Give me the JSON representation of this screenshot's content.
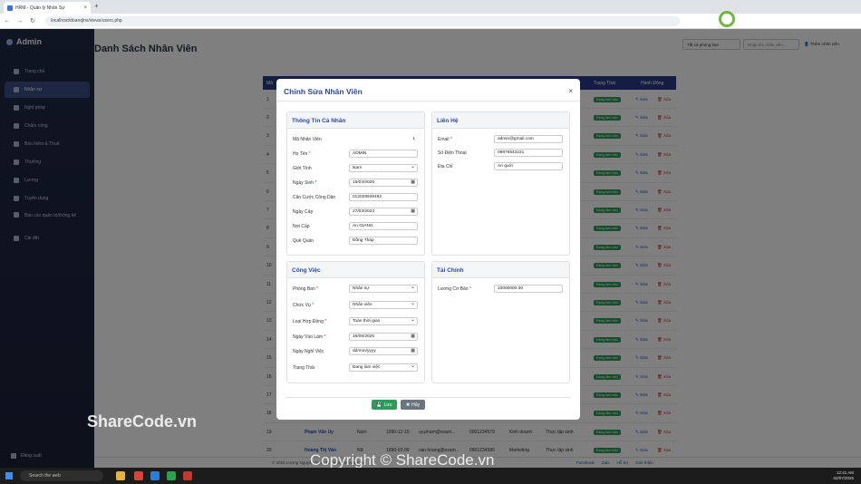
{
  "browser": {
    "tab_title": "HRM - Quản lý Nhân Sự",
    "url": "localhost/doanqlns/views/users.php"
  },
  "sidebar": {
    "brand": "Admin",
    "items": [
      {
        "label": "Trang chủ",
        "active": false
      },
      {
        "label": "Nhân sự",
        "active": true
      },
      {
        "label": "Nghỉ phép",
        "active": false
      },
      {
        "label": "Chấm công",
        "active": false
      },
      {
        "label": "Bảo hiểm & Thuế",
        "active": false
      },
      {
        "label": "Thưởng",
        "active": false
      },
      {
        "label": "Lương",
        "active": false
      },
      {
        "label": "Tuyển dụng",
        "active": false
      },
      {
        "label": "Báo cáo quản trị/thống kê",
        "active": false
      },
      {
        "label": "Cài đặt",
        "active": false
      }
    ],
    "logout": "Đăng xuất"
  },
  "page": {
    "title": "Danh Sách Nhân Viên",
    "filter_select": "Tất cả phòng ban",
    "search_placeholder": "Nhập tên nhân viên...",
    "add_button": "Thêm nhân viên"
  },
  "table": {
    "headers": {
      "id": "Mã",
      "status": "Trạng Thái",
      "actions": "Hành Động"
    },
    "row_numbers": [
      "1",
      "2",
      "3",
      "4",
      "5",
      "6",
      "7",
      "8",
      "9",
      "10",
      "11",
      "12",
      "13",
      "14",
      "15",
      "16",
      "17",
      "18",
      "19",
      "20"
    ],
    "status_badge": "Đang làm việc",
    "edit_label": "Sửa",
    "delete_label": "Xóa",
    "partial_rows": [
      {
        "num": "19",
        "name": "Phạm Văn Uy",
        "gender": "Nam",
        "dob": "1990-12-15",
        "email": "uy.pham@exam...",
        "phone": "0901234579",
        "dept": "Kinh doanh",
        "type": "Thực tập sinh"
      },
      {
        "num": "20",
        "name": "Hoàng Thị Vân",
        "gender": "Nữ",
        "dob": "1990-02-09",
        "email": "van.hoang@exam...",
        "phone": "0901234580",
        "dept": "Marketing",
        "type": "Thực tập sinh"
      }
    ]
  },
  "footer": {
    "copyright": "© 2025 Lương Nguyễn Ngọc Trí. All rights reserved.",
    "links": [
      "Facebook",
      "Zalo",
      "Hỗ trợ",
      "Giới thiệu"
    ]
  },
  "modal": {
    "title": "Chỉnh Sửa Nhân Viên",
    "personal": {
      "heading": "Thông Tin Cá Nhân",
      "employee_id_label": "Mã Nhân Viên",
      "employee_id": "1",
      "name_label": "Họ Tên",
      "name": "ADMIN",
      "gender_label": "Giới Tính",
      "gender": "Nam",
      "dob_label": "Ngày Sinh",
      "dob": "15/04/2025",
      "id_card_label": "Căn Cước Công Dân",
      "id_card": "012028939492",
      "issue_date_label": "Ngày Cấp",
      "issue_date": "27/03/2023",
      "issue_place_label": "Nơi Cấp",
      "issue_place": "An GIANG",
      "hometown_label": "Quê Quán",
      "hometown": "Đồng Tháp"
    },
    "contact": {
      "heading": "Liên Hệ",
      "email_label": "Email",
      "email": "admin@gmail.com",
      "phone_label": "Số Điện Thoại",
      "phone": "09876543221",
      "address_label": "Địa Chỉ",
      "address": "An quới"
    },
    "work": {
      "heading": "Công Việc",
      "dept_label": "Phòng Ban",
      "dept": "Nhân sự",
      "position_label": "Chức Vụ",
      "position": "Nhân viên",
      "contract_label": "Loại Hợp Đồng",
      "contract": "Toàn thời gian",
      "start_label": "Ngày Vào Làm",
      "start": "16/05/2025",
      "end_label": "Ngày Nghỉ Việc",
      "end": "dd/mm/yyyy",
      "status_label": "Trạng Thái",
      "status": "Đang làm việc"
    },
    "finance": {
      "heading": "Tài Chính",
      "salary_label": "Lương Cơ Bản",
      "salary": "10000000.00"
    },
    "save_button": "Lưu",
    "cancel_button": "Hủy"
  },
  "taskbar": {
    "search": "Search the web",
    "time": "12:41 AM",
    "date": "02/07/2025"
  },
  "watermarks": {
    "top": "SHARECODE.vn",
    "left": "ShareCode.vn",
    "bottom": "Copyright © ShareCode.vn"
  }
}
